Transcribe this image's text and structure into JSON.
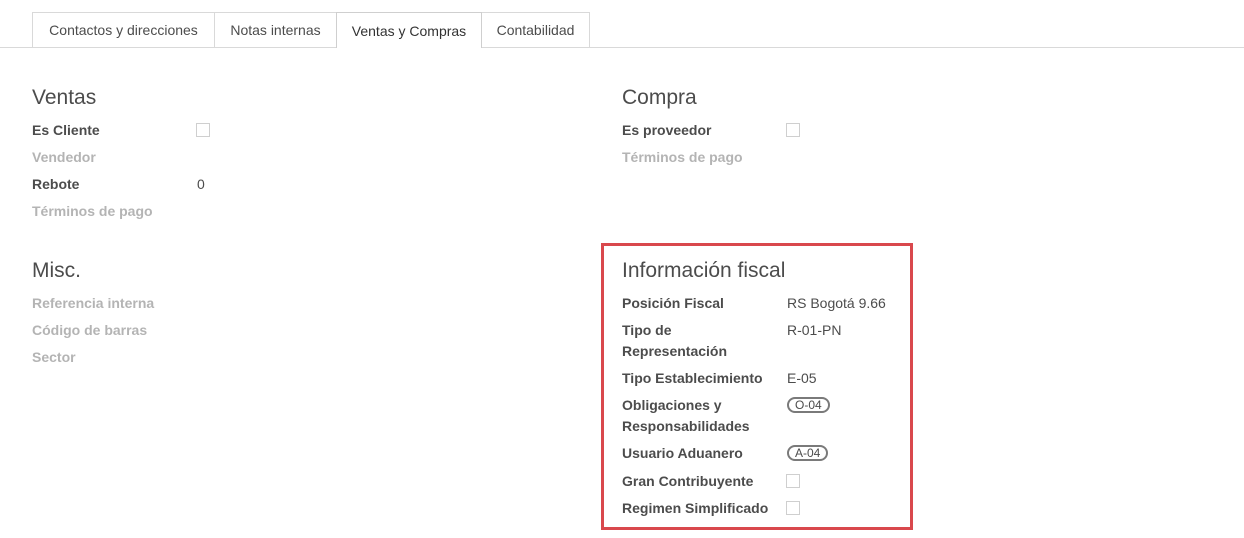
{
  "tabs": [
    {
      "label": "Contactos y direcciones",
      "active": false
    },
    {
      "label": "Notas internas",
      "active": false
    },
    {
      "label": "Ventas y Compras",
      "active": true
    },
    {
      "label": "Contabilidad",
      "active": false
    }
  ],
  "ventas": {
    "title": "Ventas",
    "es_cliente_label": "Es Cliente",
    "vendedor_label": "Vendedor",
    "rebote_label": "Rebote",
    "rebote_value": "0",
    "terminos_label": "Términos de pago"
  },
  "compra": {
    "title": "Compra",
    "es_proveedor_label": "Es proveedor",
    "terminos_label": "Términos de pago"
  },
  "misc": {
    "title": "Misc.",
    "referencia_label": "Referencia interna",
    "codigo_label": "Código de barras",
    "sector_label": "Sector"
  },
  "fiscal": {
    "title": "Información fiscal",
    "posicion_label": "Posición Fiscal",
    "posicion_value": "RS Bogotá 9.66",
    "tipo_rep_label_1": "Tipo de",
    "tipo_rep_label_2": "Representación",
    "tipo_rep_value": "R-01-PN",
    "tipo_est_label": "Tipo Establecimiento",
    "tipo_est_value": "E-05",
    "obligaciones_label_1": "Obligaciones y",
    "obligaciones_label_2": "Responsabilidades",
    "obligaciones_tag": "O-04",
    "usuario_label": "Usuario Aduanero",
    "usuario_tag": "A-04",
    "gran_label": "Gran Contribuyente",
    "regimen_label": "Regimen Simplificado"
  },
  "colors": {
    "highlight_border": "#d9484d",
    "muted_label": "#b4b4b4",
    "text": "#4c4c4c"
  }
}
